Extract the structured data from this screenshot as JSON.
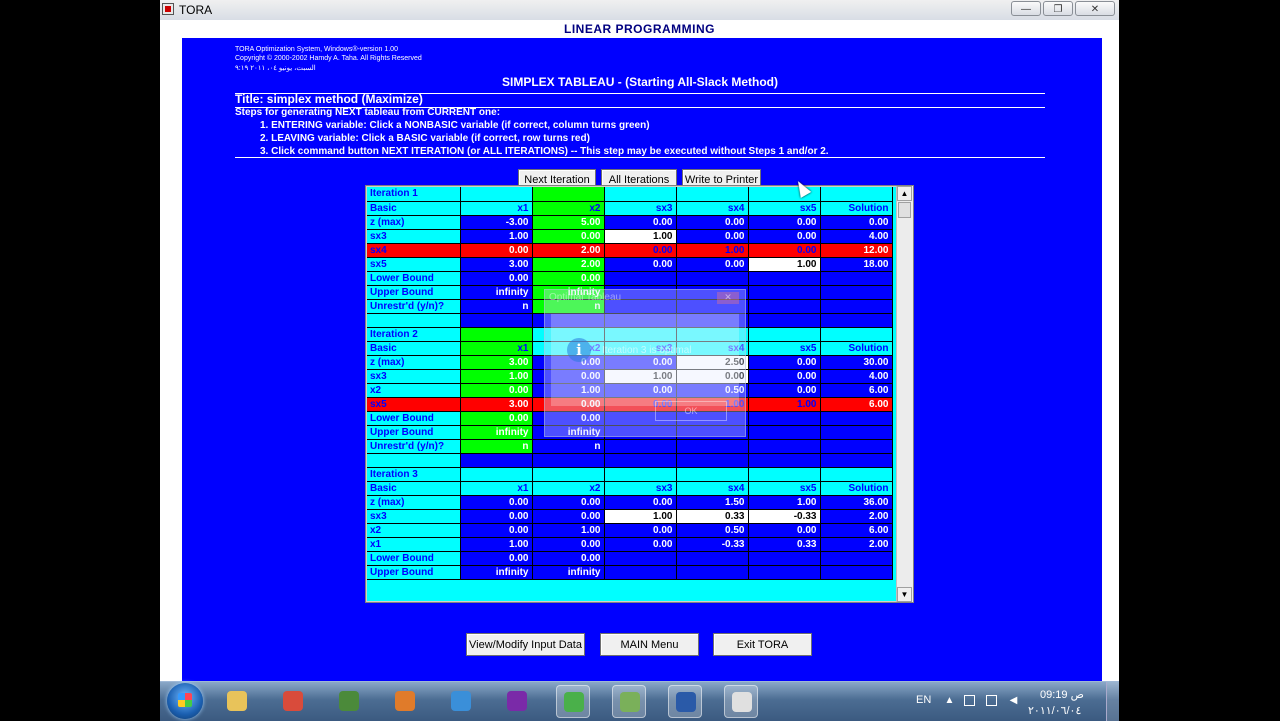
{
  "window": {
    "title": "TORA",
    "minimize": "—",
    "maximize": "❐",
    "close": "✕"
  },
  "header": {
    "app_heading": "LINEAR PROGRAMMING"
  },
  "info": {
    "version": "TORA Optimization System, Windows®-version 1.00",
    "copyright": "Copyright © 2000-2002 Hamdy A. Taha. All Rights Reserved",
    "date_line": "السبت، يونيو ٠٤، ٢٠١١ ٩:١٩"
  },
  "tableau_title": "SIMPLEX TABLEAU - (Starting All-Slack Method)",
  "problem_title": "Title: simplex method (Maximize)",
  "steps": {
    "intro": "Steps for generating NEXT tableau from CURRENT one:",
    "step1": "1.  ENTERING variable: Click a NONBASIC variable (if correct, column turns green)",
    "step2": "2.  LEAVING variable: Click a BASIC variable (if correct, row turns red)",
    "step3": "3.  Click command button NEXT ITERATION (or ALL ITERATIONS) -- This step may be executed without Steps 1 and/or 2."
  },
  "buttons": {
    "next_iteration": "Next Iteration",
    "all_iterations": "All Iterations",
    "write_printer": "Write to Printer",
    "view_modify": "View/Modify Input Data",
    "main_menu": "MAIN Menu",
    "exit": "Exit TORA"
  },
  "grid": {
    "rows": [
      [
        [
          "Iteration 1",
          "lbl"
        ],
        [
          "",
          "cyan"
        ],
        [
          "",
          "grn"
        ],
        [
          "",
          "cyan"
        ],
        [
          "",
          "cyan"
        ],
        [
          "",
          "cyan"
        ],
        [
          "",
          "cyan"
        ]
      ],
      [
        [
          "Basic",
          "lbl"
        ],
        [
          "x1",
          "hd"
        ],
        [
          "x2",
          "grn hd"
        ],
        [
          "sx3",
          "hd"
        ],
        [
          "sx4",
          "hd"
        ],
        [
          "sx5",
          "hd"
        ],
        [
          "Solution",
          "hd"
        ]
      ],
      [
        [
          "z (max)",
          "lbl"
        ],
        [
          "-3.00",
          "val"
        ],
        [
          "5.00",
          "grn"
        ],
        [
          "0.00",
          "val"
        ],
        [
          "0.00",
          "val"
        ],
        [
          "0.00",
          "val"
        ],
        [
          "0.00",
          "val"
        ]
      ],
      [
        [
          "sx3",
          "lbl"
        ],
        [
          "1.00",
          "val"
        ],
        [
          "0.00",
          "grn"
        ],
        [
          "1.00",
          "wht"
        ],
        [
          "0.00",
          "val"
        ],
        [
          "0.00",
          "val"
        ],
        [
          "4.00",
          "val"
        ]
      ],
      [
        [
          "sx4",
          "red wht"
        ],
        [
          "0.00",
          "red"
        ],
        [
          "2.00",
          "red"
        ],
        [
          "0.00",
          "red wht"
        ],
        [
          "1.00",
          "red wht"
        ],
        [
          "0.00",
          "red wht"
        ],
        [
          "12.00",
          "red"
        ]
      ],
      [
        [
          "sx5",
          "lbl"
        ],
        [
          "3.00",
          "val"
        ],
        [
          "2.00",
          "grn"
        ],
        [
          "0.00",
          "val"
        ],
        [
          "0.00",
          "val"
        ],
        [
          "1.00",
          "wht"
        ],
        [
          "18.00",
          "val"
        ]
      ],
      [
        [
          "Lower Bound",
          "lbl"
        ],
        [
          "0.00",
          "val"
        ],
        [
          "0.00",
          "grn"
        ],
        [
          "",
          "empty"
        ],
        [
          "",
          "empty"
        ],
        [
          "",
          "empty"
        ],
        [
          "",
          "empty"
        ]
      ],
      [
        [
          "Upper Bound",
          "lbl"
        ],
        [
          "infinity",
          "val"
        ],
        [
          "infinity",
          "grn"
        ],
        [
          "",
          "empty"
        ],
        [
          "",
          "empty"
        ],
        [
          "",
          "empty"
        ],
        [
          "",
          "empty"
        ]
      ],
      [
        [
          "Unrestr'd (y/n)?",
          "lbl"
        ],
        [
          "n",
          "val"
        ],
        [
          "n",
          "grn"
        ],
        [
          "",
          "empty"
        ],
        [
          "",
          "empty"
        ],
        [
          "",
          "empty"
        ],
        [
          "",
          "empty"
        ]
      ],
      [
        [
          "",
          "cyan"
        ],
        [
          "",
          "empty"
        ],
        [
          "",
          "empty"
        ],
        [
          "",
          "empty"
        ],
        [
          "",
          "empty"
        ],
        [
          "",
          "empty"
        ],
        [
          "",
          "empty"
        ]
      ],
      [
        [
          "Iteration 2",
          "lbl"
        ],
        [
          "",
          "grn"
        ],
        [
          "",
          "cyan"
        ],
        [
          "",
          "cyan"
        ],
        [
          "",
          "cyan"
        ],
        [
          "",
          "cyan"
        ],
        [
          "",
          "cyan"
        ]
      ],
      [
        [
          "Basic",
          "lbl"
        ],
        [
          "x1",
          "grn hd"
        ],
        [
          "x2",
          "hd"
        ],
        [
          "sx3",
          "hd"
        ],
        [
          "sx4",
          "hd"
        ],
        [
          "sx5",
          "hd"
        ],
        [
          "Solution",
          "hd"
        ]
      ],
      [
        [
          "z (max)",
          "lbl"
        ],
        [
          "3.00",
          "grn"
        ],
        [
          "0.00",
          "val"
        ],
        [
          "0.00",
          "val"
        ],
        [
          "2.50",
          "wht"
        ],
        [
          "0.00",
          "val"
        ],
        [
          "30.00",
          "val"
        ]
      ],
      [
        [
          "sx3",
          "lbl"
        ],
        [
          "1.00",
          "grn"
        ],
        [
          "0.00",
          "val"
        ],
        [
          "1.00",
          "wht"
        ],
        [
          "0.00",
          "wht"
        ],
        [
          "0.00",
          "val"
        ],
        [
          "4.00",
          "val"
        ]
      ],
      [
        [
          "x2",
          "lbl"
        ],
        [
          "0.00",
          "grn"
        ],
        [
          "1.00",
          "val"
        ],
        [
          "0.00",
          "val"
        ],
        [
          "0.50",
          "val"
        ],
        [
          "0.00",
          "val"
        ],
        [
          "6.00",
          "val"
        ]
      ],
      [
        [
          "sx5",
          "red wht"
        ],
        [
          "3.00",
          "red"
        ],
        [
          "0.00",
          "red"
        ],
        [
          "0.00",
          "red wht"
        ],
        [
          "1.00",
          "red wht"
        ],
        [
          "1.00",
          "red wht"
        ],
        [
          "6.00",
          "red"
        ]
      ],
      [
        [
          "Lower Bound",
          "lbl"
        ],
        [
          "0.00",
          "grn"
        ],
        [
          "0.00",
          "val"
        ],
        [
          "",
          "empty"
        ],
        [
          "",
          "empty"
        ],
        [
          "",
          "empty"
        ],
        [
          "",
          "empty"
        ]
      ],
      [
        [
          "Upper Bound",
          "lbl"
        ],
        [
          "infinity",
          "grn"
        ],
        [
          "infinity",
          "val"
        ],
        [
          "",
          "empty"
        ],
        [
          "",
          "empty"
        ],
        [
          "",
          "empty"
        ],
        [
          "",
          "empty"
        ]
      ],
      [
        [
          "Unrestr'd (y/n)?",
          "lbl"
        ],
        [
          "n",
          "grn"
        ],
        [
          "n",
          "val"
        ],
        [
          "",
          "empty"
        ],
        [
          "",
          "empty"
        ],
        [
          "",
          "empty"
        ],
        [
          "",
          "empty"
        ]
      ],
      [
        [
          "",
          "cyan"
        ],
        [
          "",
          "empty"
        ],
        [
          "",
          "empty"
        ],
        [
          "",
          "empty"
        ],
        [
          "",
          "empty"
        ],
        [
          "",
          "empty"
        ],
        [
          "",
          "empty"
        ]
      ],
      [
        [
          "Iteration 3",
          "lbl"
        ],
        [
          "",
          "cyan"
        ],
        [
          "",
          "cyan"
        ],
        [
          "",
          "cyan"
        ],
        [
          "",
          "cyan"
        ],
        [
          "",
          "cyan"
        ],
        [
          "",
          "cyan"
        ]
      ],
      [
        [
          "Basic",
          "lbl"
        ],
        [
          "x1",
          "hd"
        ],
        [
          "x2",
          "hd"
        ],
        [
          "sx3",
          "hd"
        ],
        [
          "sx4",
          "hd"
        ],
        [
          "sx5",
          "hd"
        ],
        [
          "Solution",
          "hd"
        ]
      ],
      [
        [
          "z (max)",
          "lbl"
        ],
        [
          "0.00",
          "val"
        ],
        [
          "0.00",
          "val"
        ],
        [
          "0.00",
          "val"
        ],
        [
          "1.50",
          "val"
        ],
        [
          "1.00",
          "val"
        ],
        [
          "36.00",
          "val"
        ]
      ],
      [
        [
          "sx3",
          "lbl"
        ],
        [
          "0.00",
          "val"
        ],
        [
          "0.00",
          "val"
        ],
        [
          "1.00",
          "wht"
        ],
        [
          "0.33",
          "wht"
        ],
        [
          "-0.33",
          "wht"
        ],
        [
          "2.00",
          "val"
        ]
      ],
      [
        [
          "x2",
          "lbl"
        ],
        [
          "0.00",
          "val"
        ],
        [
          "1.00",
          "val"
        ],
        [
          "0.00",
          "val"
        ],
        [
          "0.50",
          "val"
        ],
        [
          "0.00",
          "val"
        ],
        [
          "6.00",
          "val"
        ]
      ],
      [
        [
          "x1",
          "lbl"
        ],
        [
          "1.00",
          "val"
        ],
        [
          "0.00",
          "val"
        ],
        [
          "0.00",
          "val"
        ],
        [
          "-0.33",
          "val"
        ],
        [
          "0.33",
          "val"
        ],
        [
          "2.00",
          "val"
        ]
      ],
      [
        [
          "Lower Bound",
          "lbl"
        ],
        [
          "0.00",
          "val"
        ],
        [
          "0.00",
          "val"
        ],
        [
          "",
          "empty"
        ],
        [
          "",
          "empty"
        ],
        [
          "",
          "empty"
        ],
        [
          "",
          "empty"
        ]
      ],
      [
        [
          "Upper Bound",
          "lbl"
        ],
        [
          "infinity",
          "val"
        ],
        [
          "infinity",
          "val"
        ],
        [
          "",
          "empty"
        ],
        [
          "",
          "empty"
        ],
        [
          "",
          "empty"
        ],
        [
          "",
          "empty"
        ]
      ]
    ]
  },
  "dialog": {
    "title": "Optimal Tableau",
    "message": "Iteration 3 is optimal",
    "ok": "OK",
    "close": "✕",
    "icon": "i"
  },
  "taskbar": {
    "lang": "EN",
    "time": "09:19 ص",
    "date": "٢٠١١/٠٦/٠٤",
    "tray_up": "▲",
    "apps": [
      {
        "name": "explorer",
        "color": "#e8c35a"
      },
      {
        "name": "chrome",
        "color": "#d94b3b"
      },
      {
        "name": "desktop-app",
        "color": "#4b8a3a"
      },
      {
        "name": "media-player",
        "color": "#e07b2a"
      },
      {
        "name": "internet-explorer",
        "color": "#3a8fd9"
      },
      {
        "name": "yahoo-messenger",
        "color": "#7a2aa8"
      },
      {
        "name": "people",
        "color": "#4ab04a"
      },
      {
        "name": "green-app",
        "color": "#7ab05a"
      },
      {
        "name": "word",
        "color": "#2a5aa8"
      },
      {
        "name": "tora",
        "color": "#e0e0e0"
      }
    ]
  }
}
